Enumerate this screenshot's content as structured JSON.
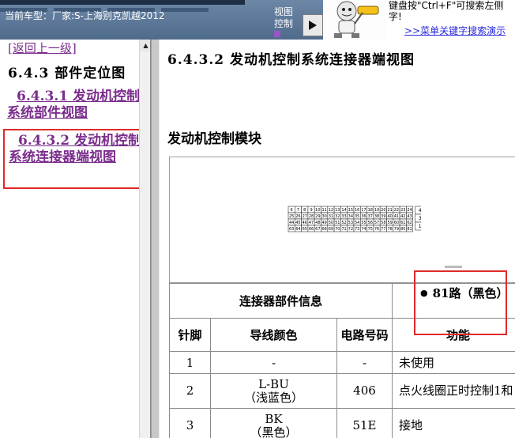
{
  "header": {
    "vehicle": "当前车型：厂家:S-上海别克凯越2012",
    "view_control": [
      "视图",
      "控制"
    ],
    "hint_text": "键盘按\"Ctrl+F\"可搜索左侧字!",
    "hint_link": ">>菜单关键字搜索演示"
  },
  "sidebar": {
    "back": "[返回上一级]",
    "section": "6.4.3 部件定位图",
    "items": [
      {
        "label": "6.4.3.1 发动机控制系统部件视图"
      },
      {
        "label": "6.4.3.2 发动机控制系统连接器端视图"
      }
    ]
  },
  "main": {
    "title": "6.4.3.2 发动机控制系统连接器端视图",
    "module": "发动机控制模块",
    "connector_info_label": "连接器部件信息",
    "circuit": "81路（黑色）",
    "table": {
      "headers": [
        "针脚",
        "导线颜色",
        "电路号码",
        "功能"
      ],
      "rows": [
        {
          "pin": "1",
          "wire": [
            "-"
          ],
          "circuit": "-",
          "func": "未使用"
        },
        {
          "pin": "2",
          "wire": [
            "L-BU",
            "（浅蓝色）"
          ],
          "circuit": "406",
          "func": "点火线圈正时控制1和"
        },
        {
          "pin": "3",
          "wire": [
            "BK",
            "（黑色）"
          ],
          "circuit": "51E",
          "func": "接地"
        }
      ]
    }
  },
  "connector_pins": {
    "row1": [
      "6",
      "7",
      "8",
      "9",
      "10",
      "11",
      "12",
      "13",
      "14",
      "15",
      "16",
      "17",
      "18",
      "19",
      "20",
      "21",
      "22",
      "23",
      "24"
    ],
    "row2": [
      "25",
      "26",
      "27",
      "28",
      "29",
      "30",
      "31",
      "32",
      "33",
      "34",
      "35",
      "36",
      "37",
      "38",
      "39",
      "40",
      "41",
      "42",
      "43"
    ],
    "row3": [
      "44",
      "45",
      "46",
      "47",
      "48",
      "49",
      "50",
      "51",
      "52",
      "53",
      "54",
      "55",
      "56",
      "57",
      "58",
      "59",
      "60",
      "61",
      "62"
    ],
    "row4": [
      "63",
      "64",
      "65",
      "66",
      "67",
      "68",
      "69",
      "70",
      "71",
      "72",
      "73",
      "74",
      "75",
      "76",
      "77",
      "78",
      "79",
      "80",
      "81"
    ],
    "side": [
      "4",
      "3",
      "1"
    ]
  },
  "colors": {
    "link": "#7a2d8c",
    "highlight": "#e02a2a",
    "header_bg": "#5a7596"
  }
}
